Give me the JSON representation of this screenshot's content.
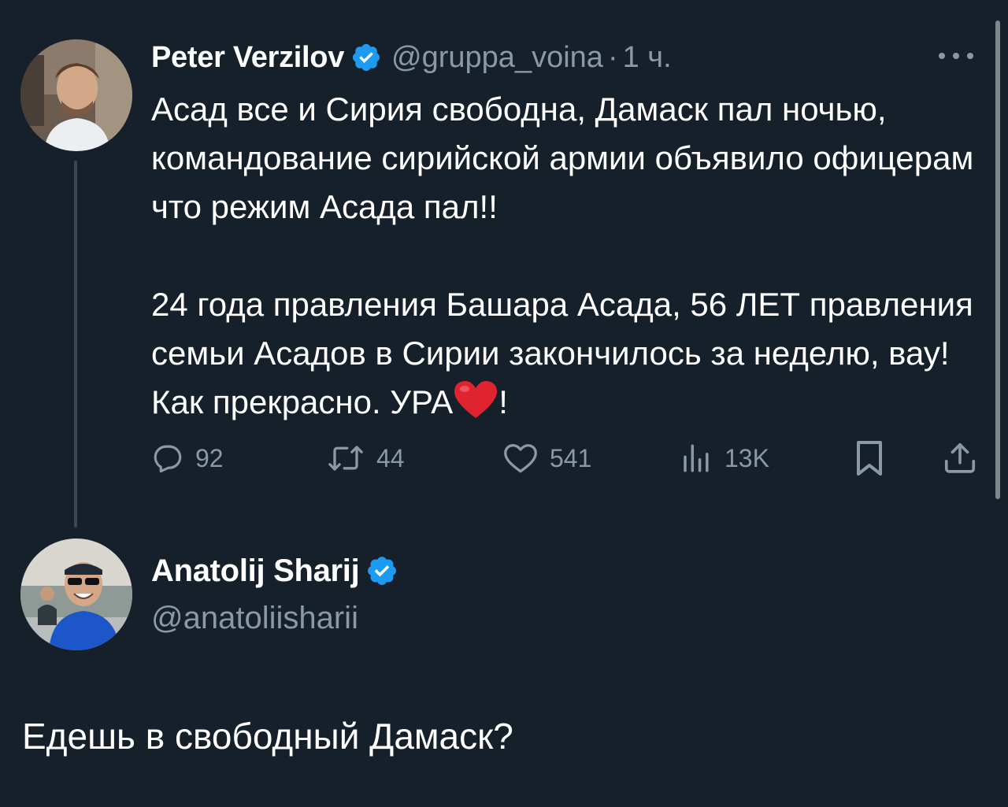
{
  "tweet": {
    "author_name": "Peter Verzilov",
    "author_handle": "@gruppa_voina",
    "separator": "·",
    "time": "1 ч.",
    "paragraph1": "Асад все и Сирия свободна, Дамаск пал ночью, командование сирийской армии объявило офицерам что режим Асада пал!!",
    "paragraph2_text": "24 года правления Башара Асада, 56 ЛЕТ правления семьи Асадов в Сирии закончилось за неделю, вау! Как прекрасно. УРА",
    "paragraph2_end": "!",
    "stats": {
      "replies": "92",
      "retweets": "44",
      "likes": "541",
      "views": "13K"
    }
  },
  "reply": {
    "author_name": "Anatolij Sharij",
    "author_handle": "@anatoliisharii",
    "text": "Едешь в свободный Дамаск?"
  },
  "colors": {
    "background": "#15202b",
    "verified_badge": "#1d9bf0",
    "muted_text": "#8b98a5",
    "heart_emoji": "#e0242f"
  },
  "icons": {
    "reply": "reply-bubble-icon",
    "retweet": "retweet-icon",
    "like": "heart-outline-icon",
    "views": "bar-chart-icon",
    "bookmark": "bookmark-icon",
    "share": "share-icon",
    "more": "more-dots-icon",
    "verified": "verified-badge-icon"
  }
}
